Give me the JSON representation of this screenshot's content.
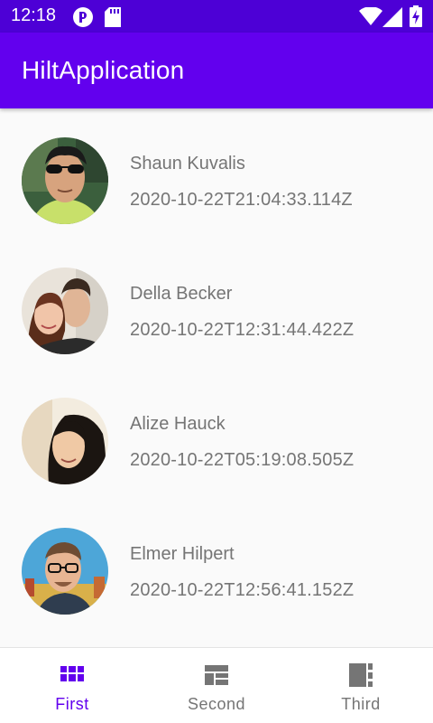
{
  "status_bar": {
    "time": "12:18",
    "icons": [
      "notification-icon",
      "sd-card-icon",
      "wifi-icon",
      "cell-signal-icon",
      "battery-charging-icon"
    ]
  },
  "app_bar": {
    "title": "HiltApplication"
  },
  "list": {
    "items": [
      {
        "name": "Shaun Kuvalis",
        "date": "2020-10-22T21:04:33.114Z"
      },
      {
        "name": "Della Becker",
        "date": "2020-10-22T12:31:44.422Z"
      },
      {
        "name": "Alize Hauck",
        "date": "2020-10-22T05:19:08.505Z"
      },
      {
        "name": "Elmer Hilpert",
        "date": "2020-10-22T12:56:41.152Z"
      }
    ]
  },
  "bottom_nav": {
    "items": [
      {
        "label": "First",
        "icon": "grid-icon",
        "active": true
      },
      {
        "label": "Second",
        "icon": "dashboard-icon",
        "active": false
      },
      {
        "label": "Third",
        "icon": "view-quilt-icon",
        "active": false
      }
    ]
  },
  "colors": {
    "status_bar": "#4d00d6",
    "primary": "#6200ee",
    "text_secondary": "#757575",
    "background": "#fafafa"
  }
}
